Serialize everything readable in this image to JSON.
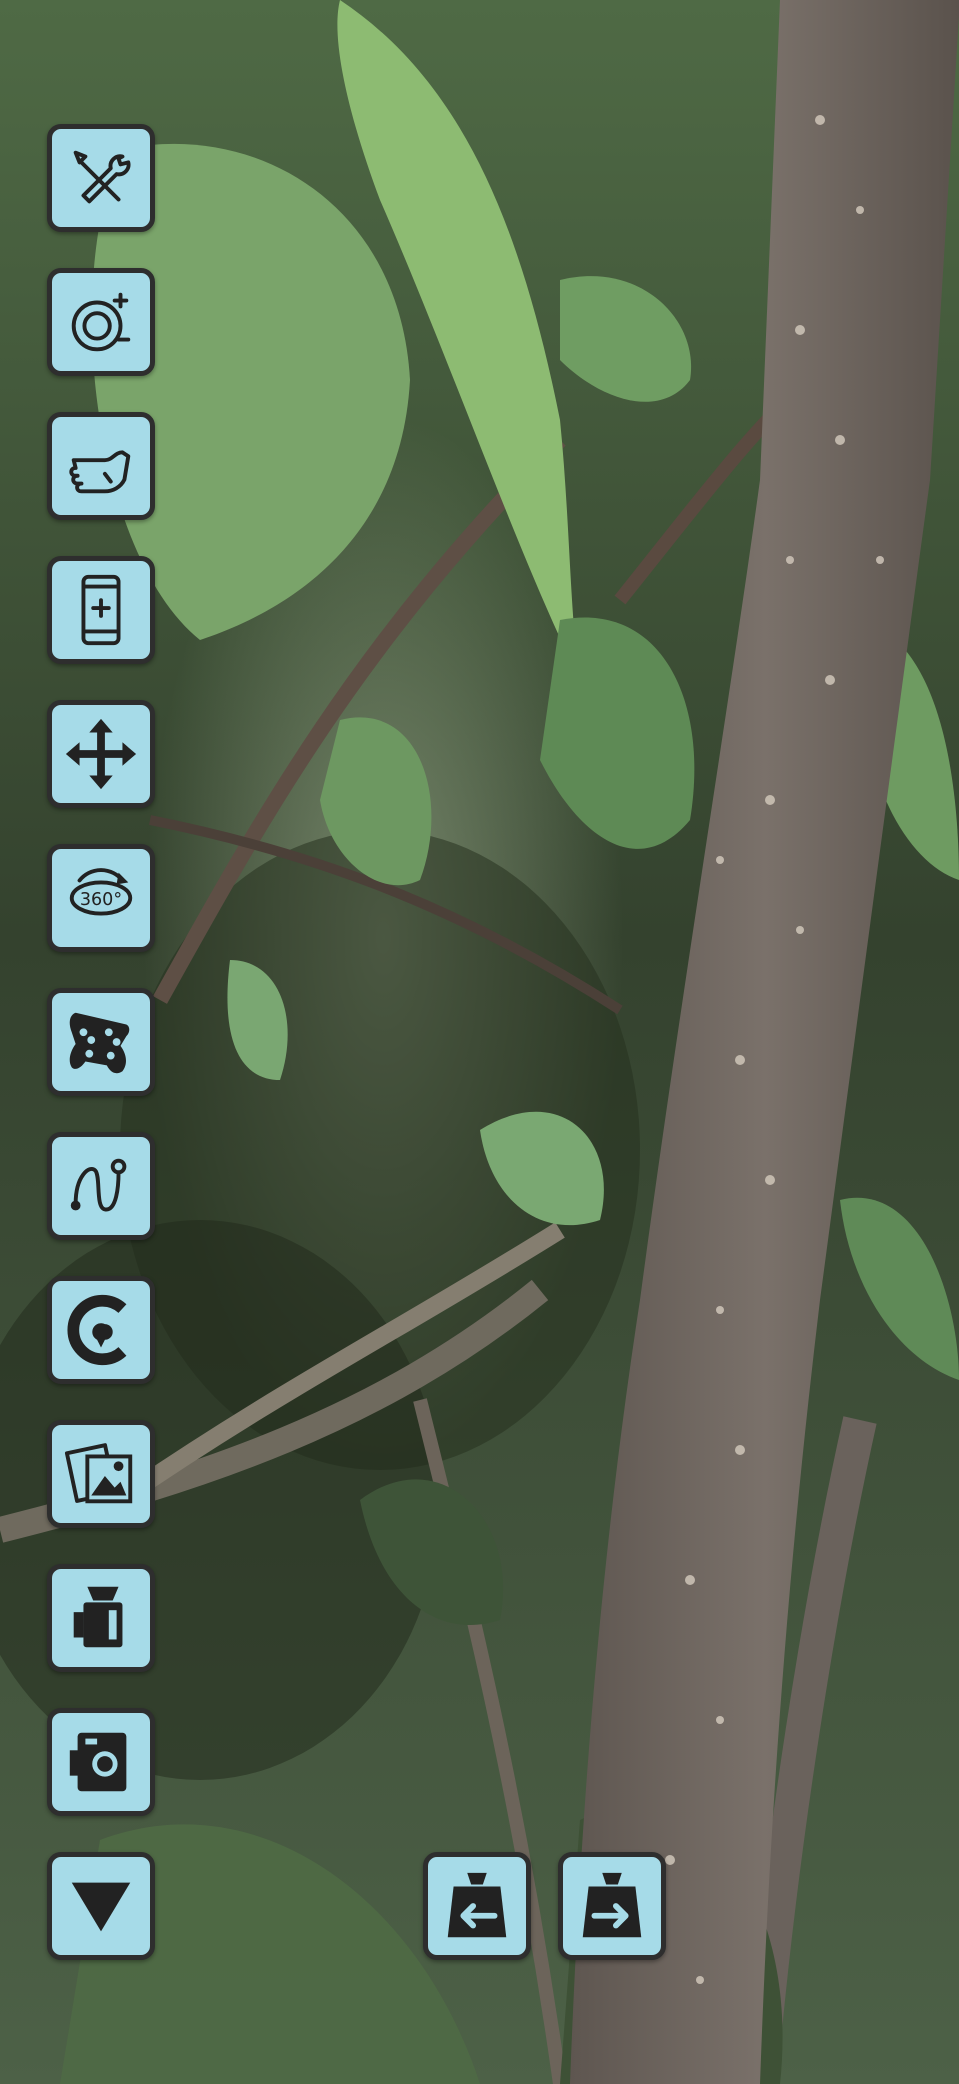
{
  "side_toolbar": [
    {
      "name": "settings-button",
      "icon": "tools-icon"
    },
    {
      "name": "zoom-button",
      "icon": "zoom-lens-icon"
    },
    {
      "name": "touch-button",
      "icon": "hand-touch-icon"
    },
    {
      "name": "phone-mount-button",
      "icon": "phone-add-icon"
    },
    {
      "name": "move-button",
      "icon": "move-arrows-icon"
    },
    {
      "name": "rotate-360-button",
      "icon": "rotate-360-icon",
      "text": "360°"
    },
    {
      "name": "gamepad-button",
      "icon": "gamepad-icon"
    },
    {
      "name": "path-button",
      "icon": "route-path-icon"
    },
    {
      "name": "compass-button",
      "icon": "compass-c-icon"
    },
    {
      "name": "gallery-button",
      "icon": "gallery-icon"
    },
    {
      "name": "video-camera-button",
      "icon": "video-camera-icon"
    },
    {
      "name": "photo-camera-button",
      "icon": "photo-camera-icon"
    },
    {
      "name": "collapse-button",
      "icon": "triangle-down-icon"
    }
  ],
  "bottom_controls": [
    {
      "name": "weight-left-button",
      "icon": "weight-arrow-left-icon"
    },
    {
      "name": "weight-right-button",
      "icon": "weight-arrow-right-icon"
    }
  ],
  "colors": {
    "button_bg": "#a6dbe8",
    "button_border": "#2e2e2e",
    "icon": "#222222"
  }
}
